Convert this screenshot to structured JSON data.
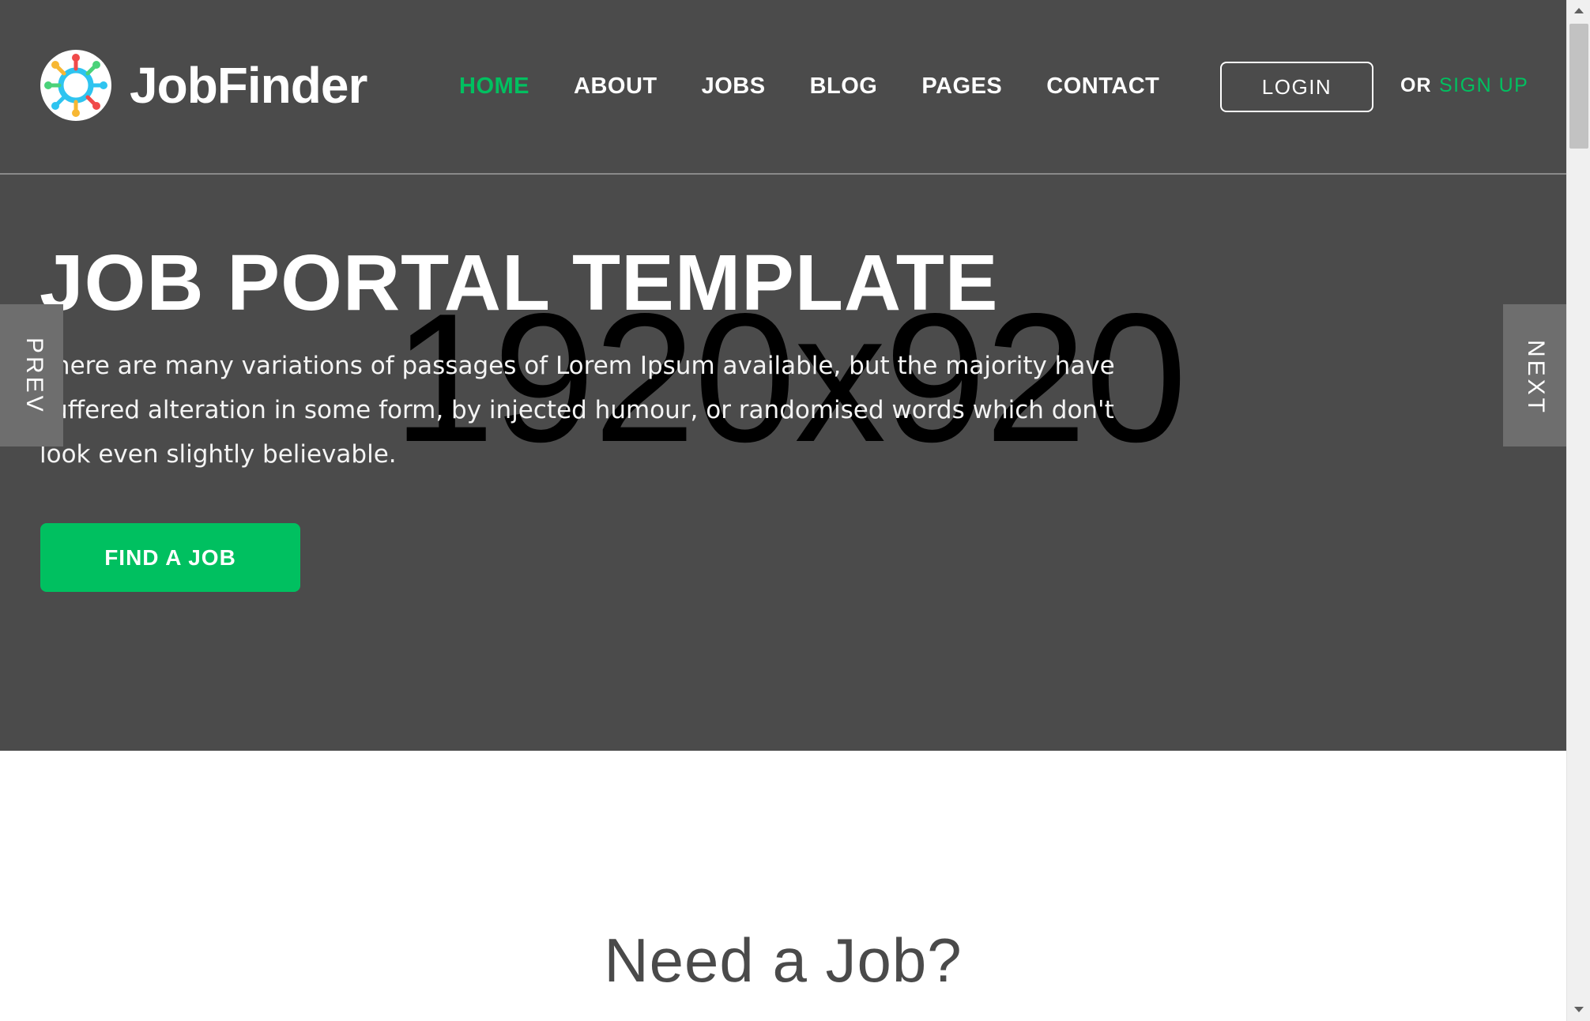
{
  "header": {
    "logo_text": "JobFinder",
    "nav": [
      {
        "label": "HOME",
        "active": true
      },
      {
        "label": "ABOUT",
        "active": false
      },
      {
        "label": "JOBS",
        "active": false
      },
      {
        "label": "BLOG",
        "active": false
      },
      {
        "label": "PAGES",
        "active": false
      },
      {
        "label": "CONTACT",
        "active": false
      }
    ],
    "login_label": "LOGIN",
    "or_text": "OR",
    "signup_label": "SIGN UP"
  },
  "hero": {
    "placeholder_text": "1920x920",
    "title": "JOB PORTAL TEMPLATE",
    "description": "There are many variations of passages of Lorem Ipsum available, but the majority have suffered alteration in some form, by injected humour, or randomised words which don't look even slightly believable.",
    "button_label": "FIND A JOB",
    "prev_label": "PREV",
    "next_label": "NEXT"
  },
  "section": {
    "title": "Need a Job?"
  },
  "colors": {
    "accent": "#00c060",
    "header_bg": "#4b4b4b",
    "hero_bg": "#4b4b4b",
    "text_light": "#ffffff",
    "section_title": "#4a4a4a"
  }
}
